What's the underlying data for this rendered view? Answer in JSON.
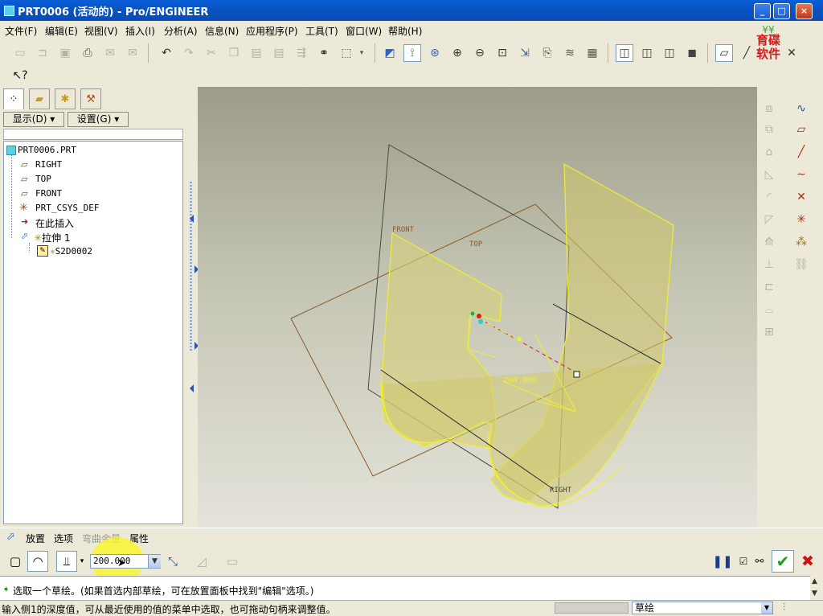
{
  "window": {
    "title": "PRT0006 (活动的) - Pro/ENGINEER",
    "min": "_",
    "max": "□",
    "close": "×"
  },
  "menu": [
    "文件(F)",
    "编辑(E)",
    "视图(V)",
    "插入(I)",
    "分析(A)",
    "信息(N)",
    "应用程序(P)",
    "工具(T)",
    "窗口(W)",
    "帮助(H)"
  ],
  "logo": {
    "line1": "育碟",
    "line2": "软件",
    "color": "#d81818"
  },
  "model_tree": {
    "display_button": "显示(D)",
    "settings_button": "设置(G)",
    "nodes": [
      "PRT0006.PRT",
      "RIGHT",
      "TOP",
      "FRONT",
      "PRT_CSYS_DEF",
      "在此插入",
      "拉伸 1",
      "S2D0002"
    ]
  },
  "viewport": {
    "labels": {
      "front": "FRONT",
      "top": "TOP",
      "right": "RIGHT"
    },
    "dimension": "200.000",
    "surface_color": "#d8d27a",
    "edge_color": "#f0ee30"
  },
  "dashboard": {
    "tabs": [
      "放置",
      "选项",
      "弯曲余量",
      "属性"
    ],
    "depth_value": "200.000"
  },
  "messages": {
    "prompt": "选取一个草绘。(如果首选内部草绘，可在放置面板中找到\"编辑\"选项。)",
    "status": "输入侧1的深度值，可从最近使用的值的菜单中选取，也可拖动句柄来调整值。",
    "filter": "草绘"
  }
}
